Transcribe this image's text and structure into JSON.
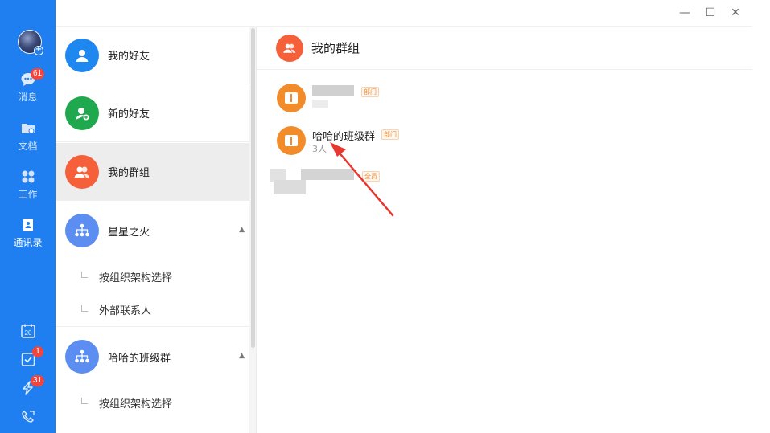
{
  "window": {
    "minimize_label": "—",
    "maximize_label": "☐",
    "close_label": "✕"
  },
  "rail": {
    "items": [
      {
        "label": "消息",
        "badge": "61",
        "icon": "chat-icon"
      },
      {
        "label": "文档",
        "badge": "",
        "icon": "folder-icon"
      },
      {
        "label": "工作",
        "badge": "",
        "icon": "apps-icon"
      },
      {
        "label": "通讯录",
        "badge": "",
        "icon": "contacts-icon"
      }
    ],
    "bottom": [
      {
        "icon": "calendar-icon",
        "text": "20",
        "badge": ""
      },
      {
        "icon": "task-check-icon",
        "badge": "1"
      },
      {
        "icon": "lightning-icon",
        "badge": "31"
      },
      {
        "icon": "phone-icon",
        "badge": ""
      }
    ]
  },
  "contacts": {
    "entries": [
      {
        "label": "我的好友",
        "icon": "person-icon",
        "color": "#1e88f0"
      },
      {
        "label": "新的好友",
        "icon": "person-add-icon",
        "color": "#1fa84d"
      },
      {
        "label": "我的群组",
        "icon": "group-icon",
        "color": "#f5603a"
      },
      {
        "label": "星星之火",
        "icon": "org-chart-icon",
        "color": "#5b8ef0"
      }
    ],
    "org1_subs": [
      "按组织架构选择",
      "外部联系人"
    ],
    "org2": {
      "label": "哈哈的班级群",
      "icon": "org-chart-icon",
      "color": "#5b8ef0"
    },
    "org2_subs": [
      "按组织架构选择"
    ]
  },
  "panel": {
    "title": "我的群组",
    "groups": [
      {
        "name": "",
        "tag": "部门",
        "count": ""
      },
      {
        "name": "哈哈的班级群",
        "tag": "部门",
        "count": "3人"
      },
      {
        "name": "",
        "tag": "全员",
        "count": ""
      }
    ]
  },
  "colors": {
    "rail": "#1f7ff0",
    "accent_orange": "#f28c2b",
    "arrow_red": "#e8372f"
  }
}
